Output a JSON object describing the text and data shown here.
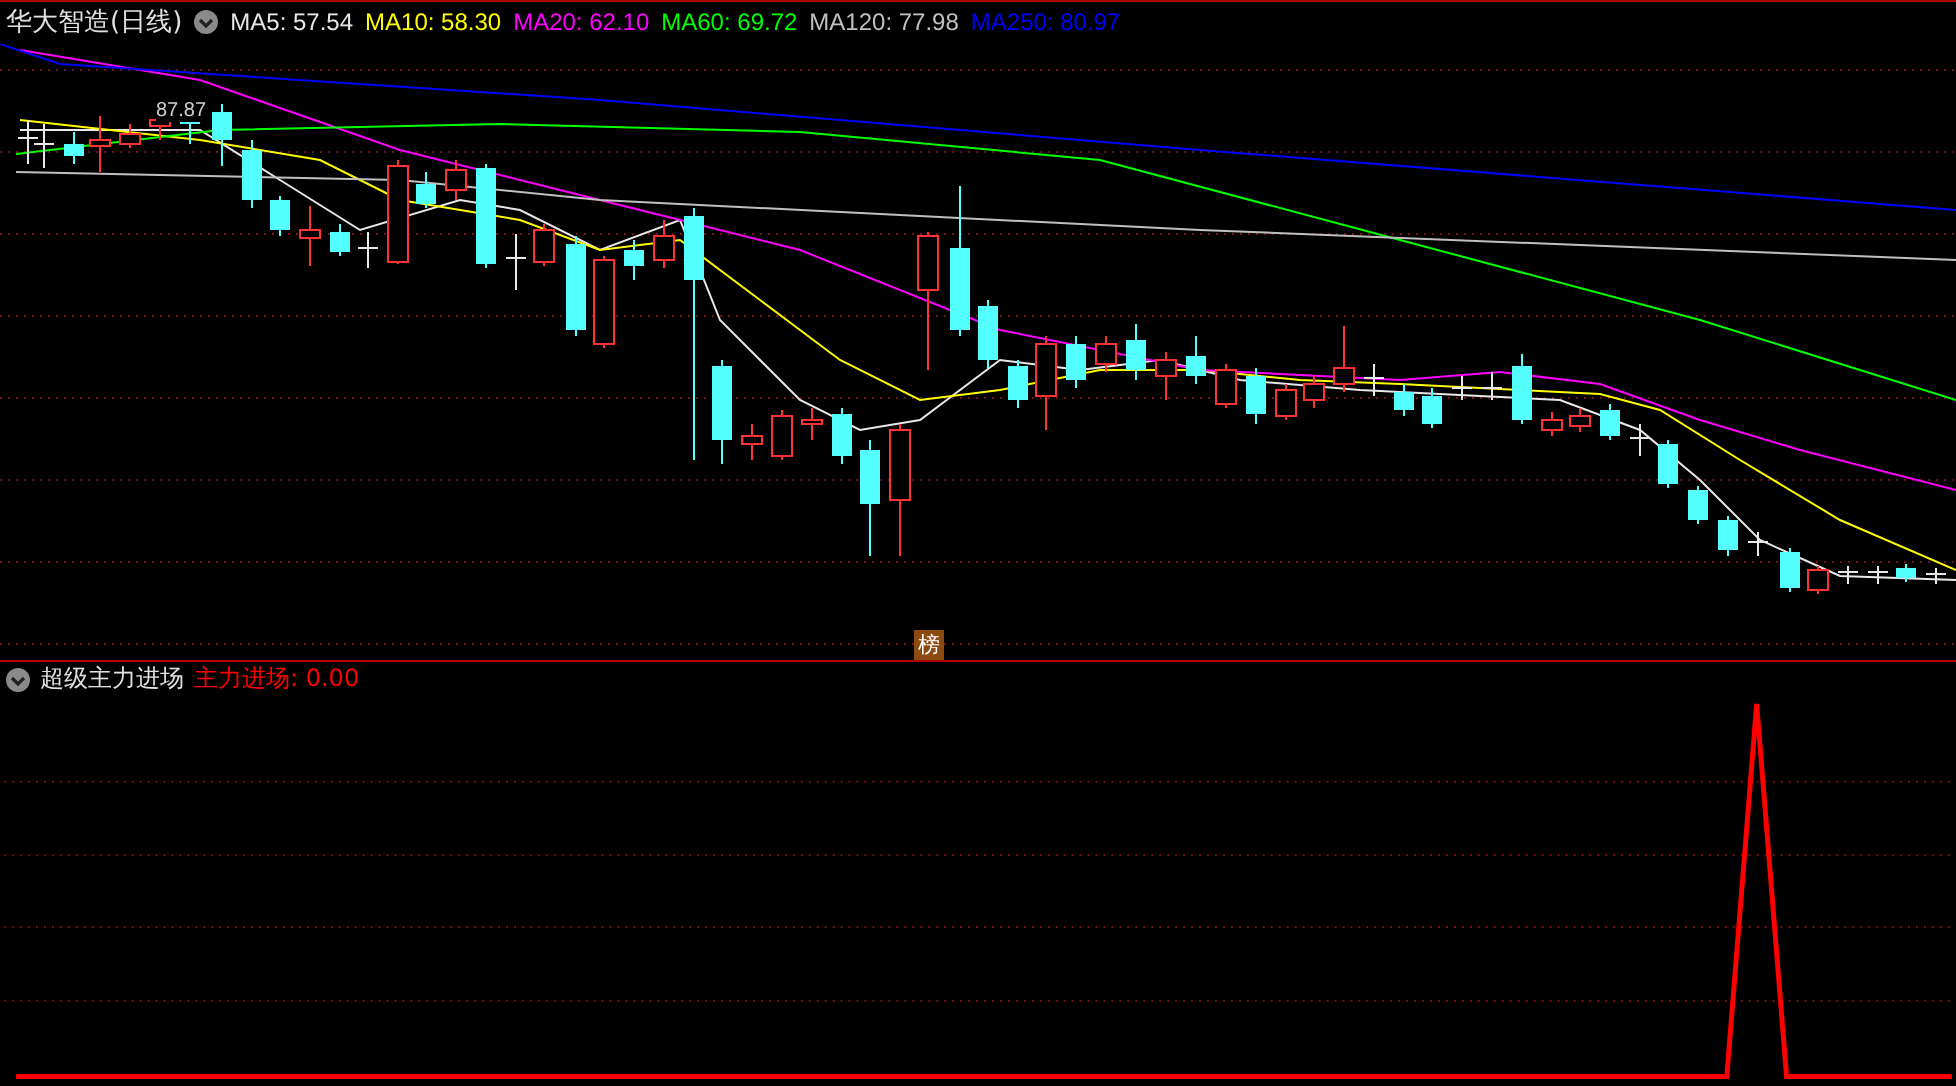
{
  "header": {
    "title": "华大智造(日线)",
    "legend": [
      {
        "label": "MA5: 57.54",
        "color": "#e8e8e8"
      },
      {
        "label": "MA10: 58.30",
        "color": "#ffff00"
      },
      {
        "label": "MA20: 62.10",
        "color": "#ff00ff"
      },
      {
        "label": "MA60: 69.72",
        "color": "#00ff00"
      },
      {
        "label": "MA120: 77.98",
        "color": "#c0c0c0"
      },
      {
        "label": "MA250: 80.97",
        "color": "#0000ff"
      }
    ]
  },
  "main_chart": {
    "high_label": "87.87",
    "badge": "榜"
  },
  "indicator": {
    "name": "超级主力进场",
    "value": "主力进场: 0.00"
  }
}
